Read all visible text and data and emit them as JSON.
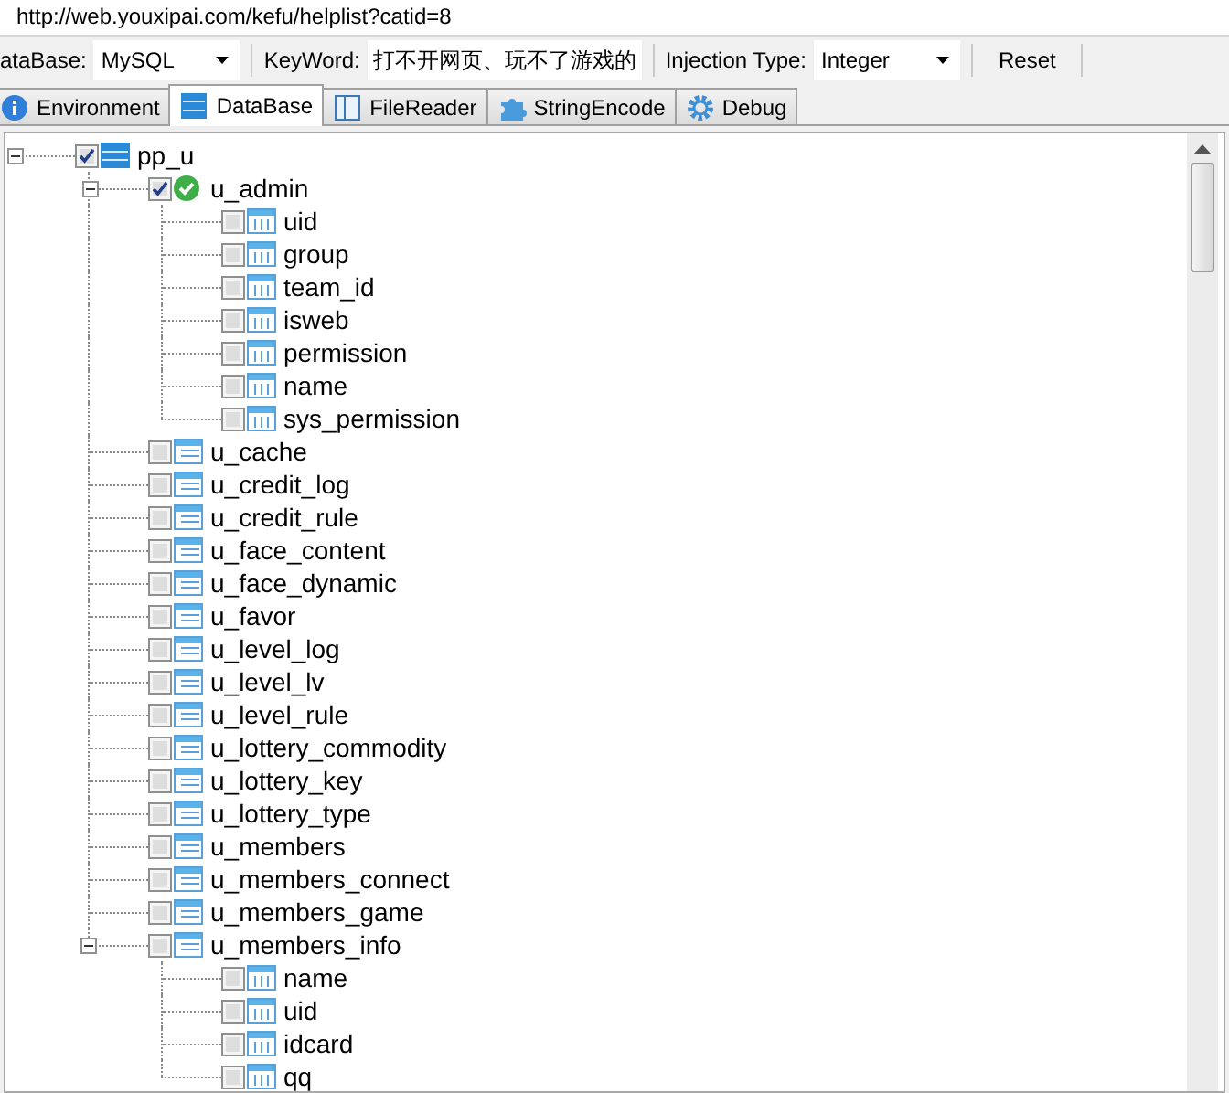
{
  "address_bar": {
    "url": "http://web.youxipai.com/kefu/helplist?catid=8"
  },
  "toolbar": {
    "database_label": "ataBase:",
    "database": "MySQL",
    "keyword_label": "KeyWord:",
    "keyword": "打不开网页、玩不了游戏的",
    "injection_label": "Injection Type:",
    "injection": "Integer",
    "reset": "Reset"
  },
  "tabs": [
    {
      "label": "Environment",
      "selected": false
    },
    {
      "label": "DataBase",
      "selected": true
    },
    {
      "label": "FileReader",
      "selected": false
    },
    {
      "label": "StringEncode",
      "selected": false
    },
    {
      "label": "Debug",
      "selected": false
    }
  ],
  "tree": [
    {
      "label": "pp_u",
      "kind": "database",
      "checked": true,
      "expanded": true,
      "children": [
        {
          "label": "u_admin",
          "kind": "table-done",
          "checked": true,
          "expanded": true,
          "children": [
            {
              "label": "uid",
              "kind": "column",
              "checked": false
            },
            {
              "label": "group",
              "kind": "column",
              "checked": false
            },
            {
              "label": "team_id",
              "kind": "column",
              "checked": false
            },
            {
              "label": "isweb",
              "kind": "column",
              "checked": false
            },
            {
              "label": "permission",
              "kind": "column",
              "checked": false
            },
            {
              "label": "name",
              "kind": "column",
              "checked": false
            },
            {
              "label": "sys_permission",
              "kind": "column",
              "checked": false
            }
          ]
        },
        {
          "label": "u_cache",
          "kind": "table",
          "checked": false
        },
        {
          "label": "u_credit_log",
          "kind": "table",
          "checked": false
        },
        {
          "label": "u_credit_rule",
          "kind": "table",
          "checked": false
        },
        {
          "label": "u_face_content",
          "kind": "table",
          "checked": false
        },
        {
          "label": "u_face_dynamic",
          "kind": "table",
          "checked": false
        },
        {
          "label": "u_favor",
          "kind": "table",
          "checked": false
        },
        {
          "label": "u_level_log",
          "kind": "table",
          "checked": false
        },
        {
          "label": "u_level_lv",
          "kind": "table",
          "checked": false
        },
        {
          "label": "u_level_rule",
          "kind": "table",
          "checked": false
        },
        {
          "label": "u_lottery_commodity",
          "kind": "table",
          "checked": false
        },
        {
          "label": "u_lottery_key",
          "kind": "table",
          "checked": false
        },
        {
          "label": "u_lottery_type",
          "kind": "table",
          "checked": false
        },
        {
          "label": "u_members",
          "kind": "table",
          "checked": false
        },
        {
          "label": "u_members_connect",
          "kind": "table",
          "checked": false
        },
        {
          "label": "u_members_game",
          "kind": "table",
          "checked": false
        },
        {
          "label": "u_members_info",
          "kind": "table",
          "checked": false,
          "expanded": true,
          "children": [
            {
              "label": "name",
              "kind": "column",
              "checked": false
            },
            {
              "label": "uid",
              "kind": "column",
              "checked": false
            },
            {
              "label": "idcard",
              "kind": "column",
              "checked": false
            },
            {
              "label": "qq",
              "kind": "column",
              "checked": false
            }
          ]
        }
      ]
    }
  ]
}
